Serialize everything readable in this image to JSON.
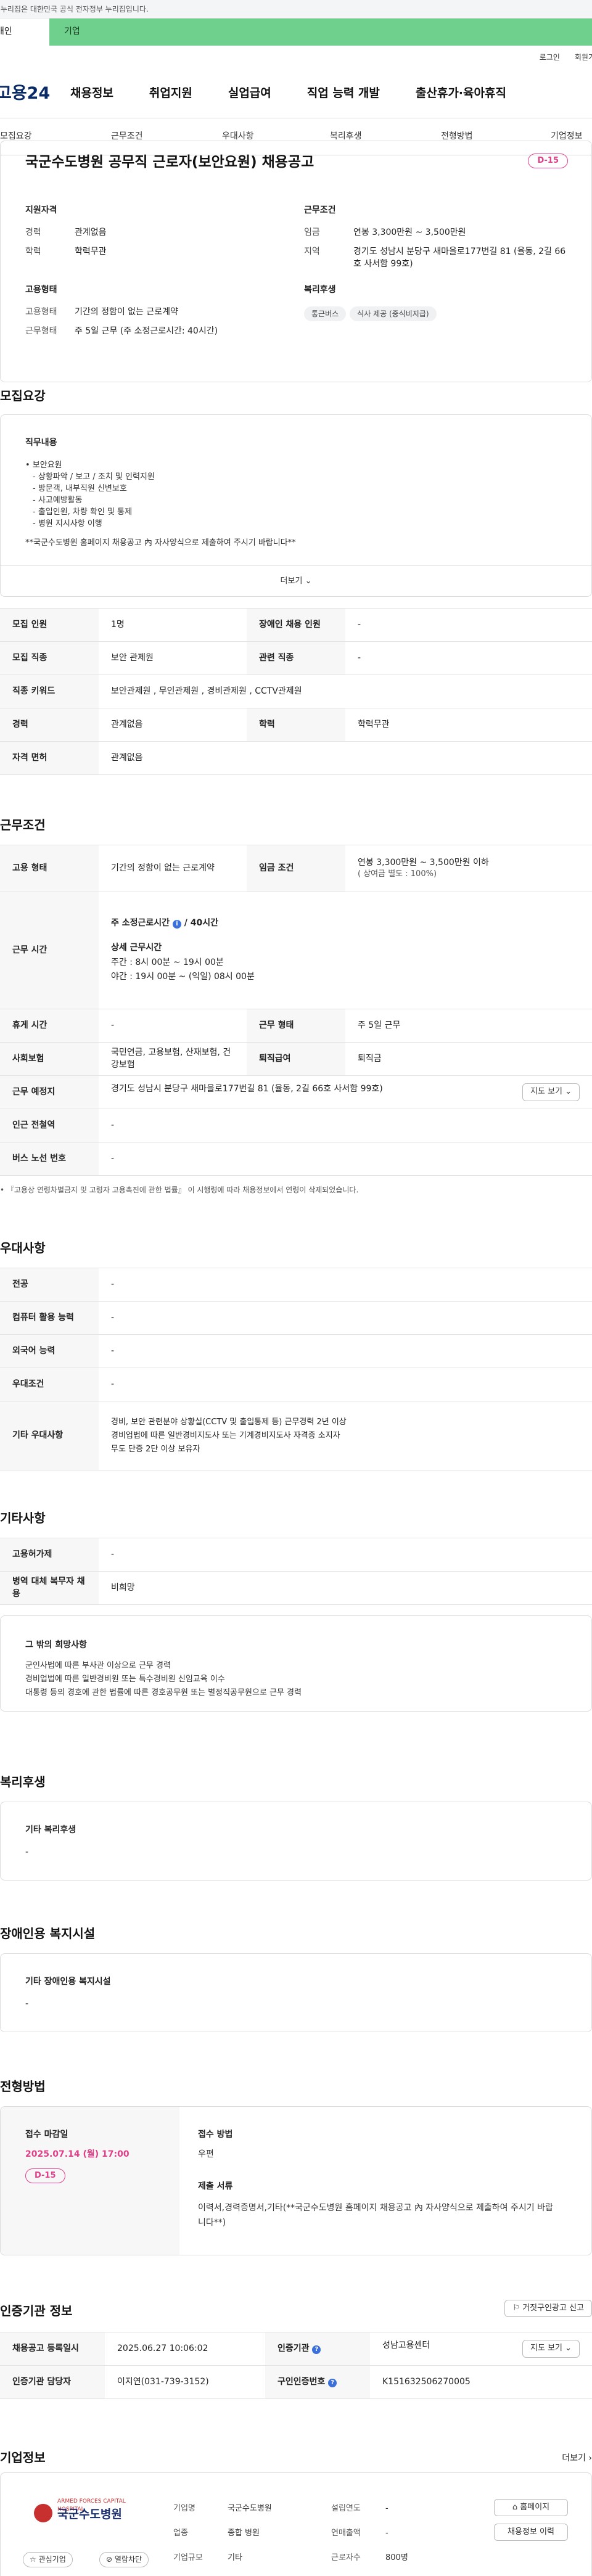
{
  "gov_banner": "이 누리집은 대한민국 공식 전자정부 누리집입니다.",
  "top_tabs": {
    "personal": "개인",
    "company": "기업"
  },
  "util": {
    "login": "로그인",
    "join": "회원가입"
  },
  "logo": "고용24",
  "gnb": [
    "채용정보",
    "취업지원",
    "실업급여",
    "직업 능력 개발",
    "출산휴가·육아휴직"
  ],
  "anchor_tabs": [
    "모집요강",
    "근무조건",
    "우대사항",
    "복리후생",
    "전형방법",
    "기업정보"
  ],
  "job": {
    "title": "국군수도병원 공무직 근로자(보안요원) 채용공고",
    "dday": "D-15",
    "qual_title": "지원자격",
    "career_label": "경력",
    "career": "관계없음",
    "edu_label": "학력",
    "edu": "학력무관",
    "cond_title": "근무조건",
    "wage_label": "임금",
    "wage": "연봉 3,300만원 ~ 3,500만원",
    "region_label": "지역",
    "region": "경기도 성남시 분당구 새마을로177번길 81 (율동, 2길 66호 사서함 99호)",
    "form_title": "고용형태",
    "emp_label": "고용형태",
    "emp": "기간의 정함이 없는 근로계약",
    "work_label": "근무형태",
    "work": "주 5일 근무 (주 소정근로시간: 40시간)",
    "welfare_title": "복리후생",
    "chips": [
      "통근버스",
      "식사 제공 (중식비지급)"
    ]
  },
  "recruit": {
    "heading": "모집요강",
    "duty_title": "직무내용",
    "duty_lines": [
      "• 보안요원",
      "- 상황파악 / 보고 / 조치 및 인력지원",
      "- 방문객, 내부직원 신변보호",
      "- 사고예방활동",
      "- 출입인원, 차량 확인 및 통제",
      "- 병원 지시사항 이행",
      "",
      "**국군수도병원 홈페이지 채용공고 內 자사양식으로 제출하여 주시기 바랍니다**"
    ],
    "more": "더보기",
    "rows": [
      {
        "k1": "모집 인원",
        "v1": "1명",
        "k2": "장애인 채용 인원",
        "v2": "-"
      },
      {
        "k1": "모집 직종",
        "v1": "보안 관제원",
        "k2": "관련 직종",
        "v2": "-"
      },
      {
        "k1": "직종 키워드",
        "v1": "보안관제원 , 무인관제원 , 경비관제원 , CCTV관제원"
      },
      {
        "k1": "경력",
        "v1": "관계없음",
        "k2": "학력",
        "v2": "학력무관"
      },
      {
        "k1": "자격 면허",
        "v1": "관계없음"
      }
    ]
  },
  "conditions": {
    "heading": "근무조건",
    "emp_type_k": "고용 형태",
    "emp_type_v": "기간의 정함이 없는 근로계약",
    "wage_k": "임금 조건",
    "wage_v": "연봉 3,300만원 ~ 3,500만원 이하",
    "wage_sub": "( 상여금 별도 : 100%)",
    "hours_k": "근무 시간",
    "hours_main": "주 소정근로시간",
    "hours_val": "40시간",
    "hours_detail_title": "상세 근무시간",
    "hours_day": "주간 : 8시 00분 ~ 19시 00분",
    "hours_night": "야간 : 19시 00분 ~ (익일) 08시 00분",
    "rest_k": "휴게 시간",
    "rest_v": "-",
    "form_k": "근무 형태",
    "form_v": "주 5일 근무",
    "ins_k": "사회보험",
    "ins_v": "국민연금, 고용보험, 산재보험, 건강보험",
    "sev_k": "퇴직급여",
    "sev_v": "퇴직금",
    "place_k": "근무 예정지",
    "place_v": "경기도 성남시 분당구 새마을로177번길 81 (율동, 2길 66호 사서함 99호)",
    "map_btn": "지도 보기",
    "subway_k": "인근 전철역",
    "subway_v": "-",
    "bus_k": "버스 노선 번호",
    "bus_v": "-",
    "note": "• 『고용상 연령차별금지 및 고령자 고용촉진에 관한 법률』 이 시행령에 따라 채용정보에서 연령이 삭제되었습니다."
  },
  "pref": {
    "heading": "우대사항",
    "rows": [
      {
        "k": "전공",
        "v": "-"
      },
      {
        "k": "컴퓨터 활용 능력",
        "v": "-"
      },
      {
        "k": "외국어 능력",
        "v": "-"
      },
      {
        "k": "우대조건",
        "v": "-"
      }
    ],
    "etc_k": "기타 우대사항",
    "etc_lines": [
      "경비, 보안 관련분야 상황실(CCTV 및 출입통제 등) 근무경력 2년 이상",
      "경비업법에 따른 일반경비지도사 또는 기계경비지도사 자격증 소지자",
      "무도 단증 2단 이상 보유자"
    ]
  },
  "etc": {
    "heading": "기타사항",
    "ins_k": "고용허가제",
    "ins_v": "-",
    "mil_k": "병역 대체 복무자 채용",
    "mil_v": "비희망",
    "other_title": "그 밖의 희망사항",
    "other_lines": [
      "군인사법에 따른 부사관 이상으로 근무 경력",
      "경비업법에 따른 일반경비원 또는 특수경비원 신임교육 이수",
      "대통령 등의 경호에 관한 법률에 따른 경호공무원 또는 별정직공무원으로 근무 경력"
    ]
  },
  "welfare": {
    "heading": "복리후생",
    "box_title": "기타 복리후생",
    "box_value": "-"
  },
  "disabled": {
    "heading": "장애인용 복지시설",
    "box_title": "기타 장애인용 복지시설",
    "box_value": "-"
  },
  "process": {
    "heading": "전형방법",
    "deadline_title": "접수 마감일",
    "deadline": "2025.07.14 (월) 17:00",
    "dday": "D-15",
    "method_title": "접수 방법",
    "method": "우편",
    "docs_title": "제출 서류",
    "docs": "이력서,경력증명서,기타(**국군수도병원 홈페이지 채용공고 內 자사양식으로 제출하여 주시기 바랍니다**)"
  },
  "manager": {
    "heading": "인증기관 정보",
    "report_btn": "거짓구인광고 신고",
    "reg_k": "채용공고 등록일시",
    "reg_v": "2025.06.27 10:06:02",
    "agency_k": "인증기관",
    "agency_v": "성남고용센터",
    "map_btn": "지도 보기",
    "person_k": "인증기관 담당자",
    "person_v": "이지연(031-739-3152)",
    "num_k": "구인인증번호",
    "num_v": "K151632506270005"
  },
  "company": {
    "heading": "기업정보",
    "more": "더보기",
    "logo_text": "국군수도병원",
    "logo_sub": "ARMED FORCES CAPITAL HOSPITAL",
    "interest": "관심기업",
    "block": "열람차단",
    "name_k": "기업명",
    "name_v": "국군수도병원",
    "ind_k": "업종",
    "ind_v": "종합 병원",
    "size_k": "기업규모",
    "size_v": "기타",
    "year_k": "설립연도",
    "year_v": "-",
    "sales_k": "연매출액",
    "sales_v": "-",
    "emp_k": "근로자수",
    "emp_v": "800명",
    "home_btn": "홈페이지",
    "list_btn": "채용정보 이력"
  }
}
